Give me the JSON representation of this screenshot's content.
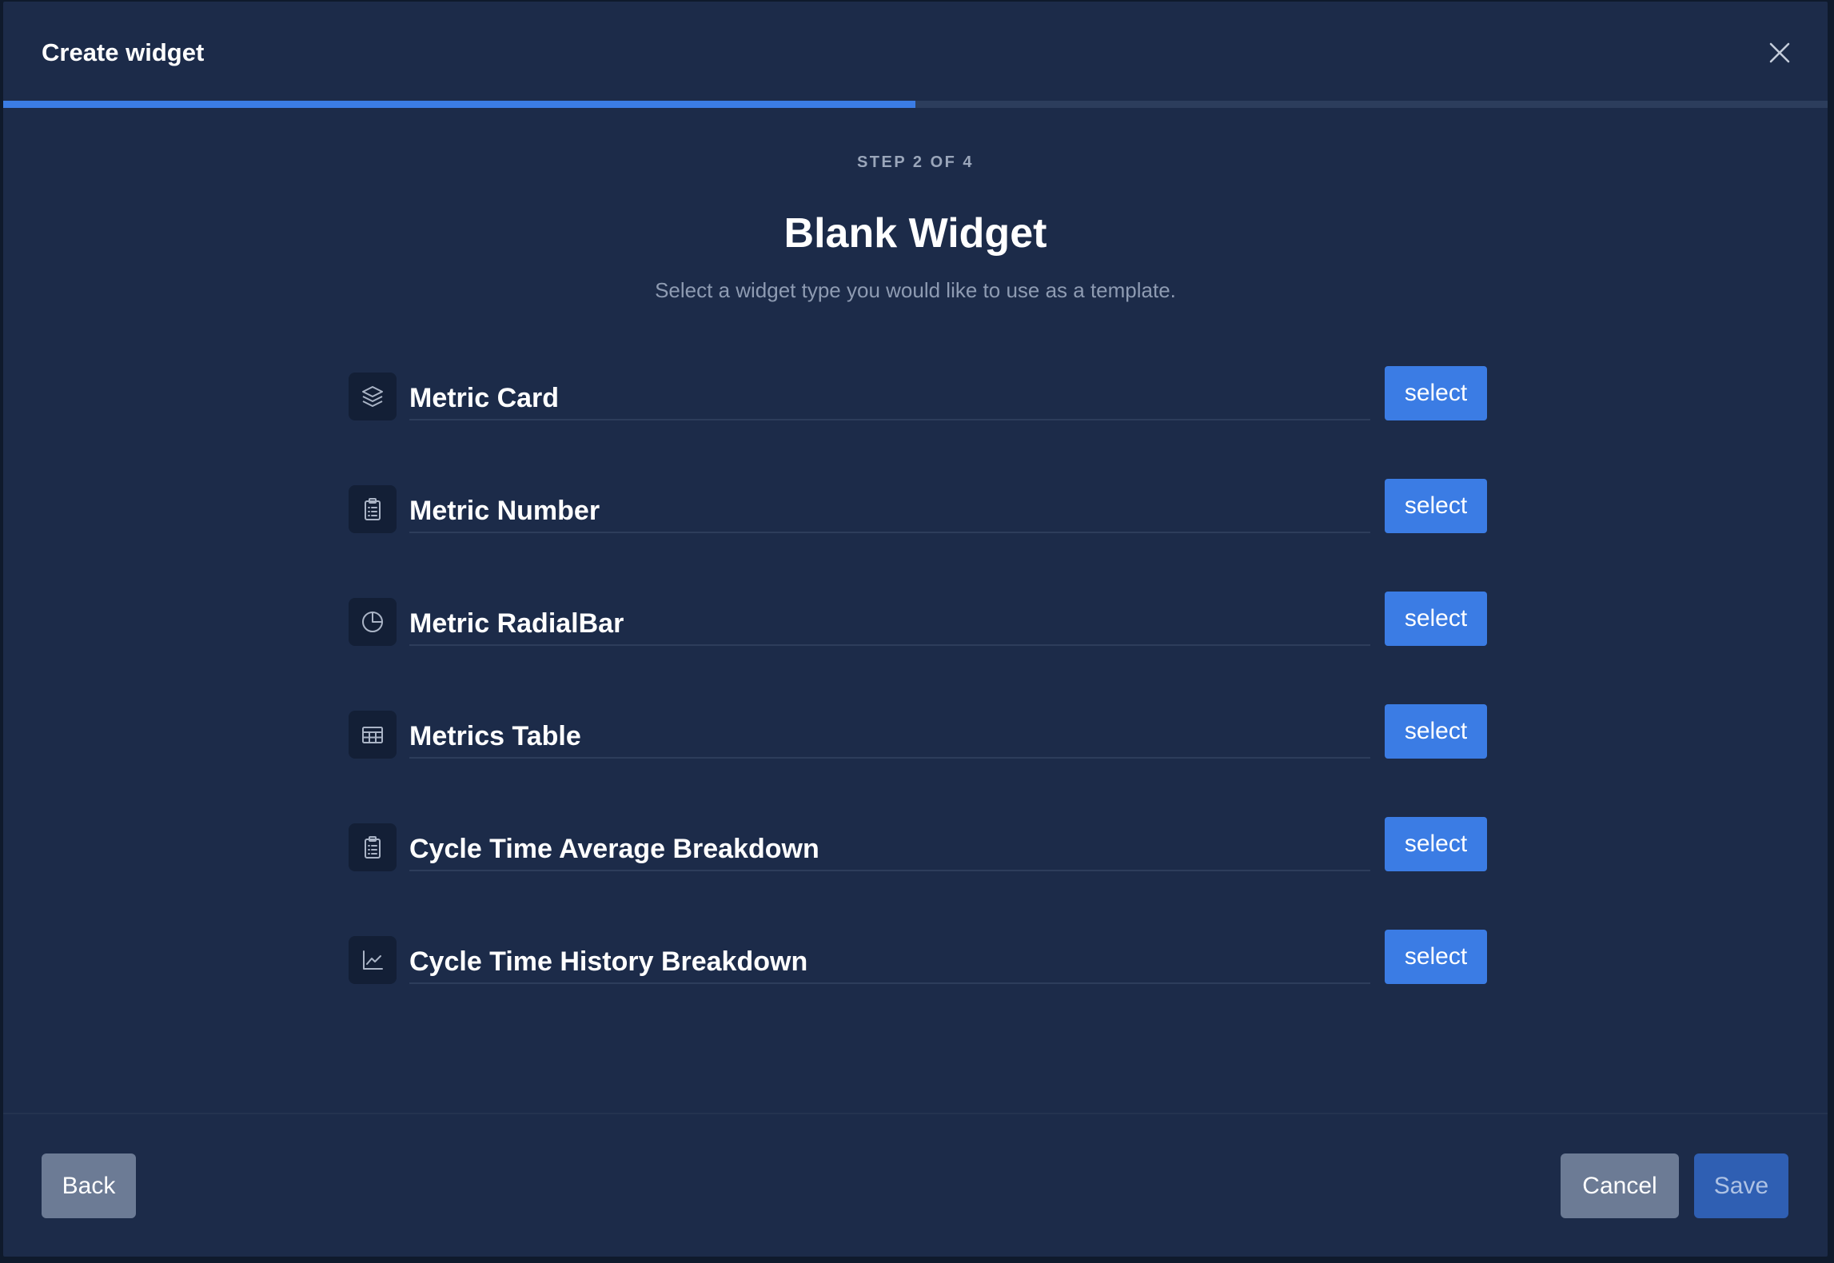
{
  "modal": {
    "title": "Create widget",
    "close_icon": "close-icon"
  },
  "progress": {
    "current_step": 2,
    "total_steps": 4,
    "fraction": 0.5
  },
  "step_label": "STEP 2 OF 4",
  "title": "Blank Widget",
  "subtitle": "Select a widget type you would like to use as a template.",
  "widgets": [
    {
      "name": "Metric Card",
      "icon": "layers-icon",
      "button": "select"
    },
    {
      "name": "Metric Number",
      "icon": "clipboard-list-icon",
      "button": "select"
    },
    {
      "name": "Metric RadialBar",
      "icon": "pie-chart-icon",
      "button": "select"
    },
    {
      "name": "Metrics Table",
      "icon": "table-icon",
      "button": "select"
    },
    {
      "name": "Cycle Time Average Breakdown",
      "icon": "clipboard-list-icon",
      "button": "select"
    },
    {
      "name": "Cycle Time History Breakdown",
      "icon": "line-chart-icon",
      "button": "select"
    }
  ],
  "footer": {
    "back_label": "Back",
    "cancel_label": "Cancel",
    "save_label": "Save"
  },
  "colors": {
    "background": "#1c2b49",
    "accent": "#3b7ce4",
    "secondary_button": "#6c7b95",
    "disabled_primary": "#2f5fb3"
  }
}
